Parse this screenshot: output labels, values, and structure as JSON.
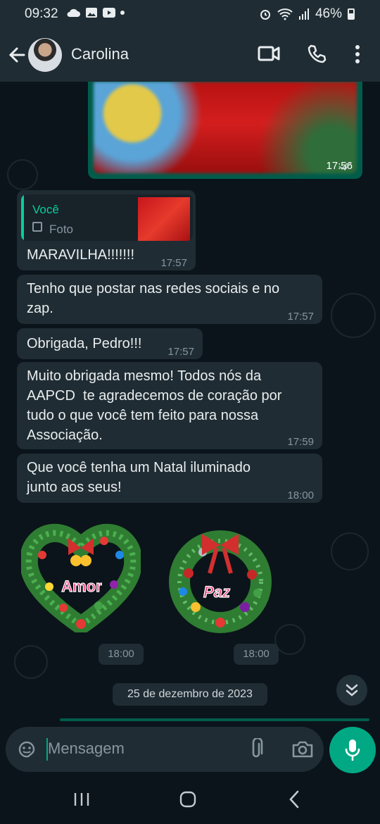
{
  "status_bar": {
    "time": "09:32",
    "battery": "46%"
  },
  "header": {
    "contact_name": "Carolina"
  },
  "messages": {
    "image_time": "17:56",
    "quoted_reply": {
      "who": "Você",
      "what": "Foto",
      "text": "MARAVILHA!!!!!!!",
      "time": "17:57"
    },
    "m1": {
      "text_l1": "Tenho que postar nas redes sociais e no",
      "text_l2": "zap.",
      "time": "17:57"
    },
    "m2": {
      "text": "Obrigada, Pedro!!!",
      "time": "17:57"
    },
    "m3": {
      "text_l1": "Muito obrigada mesmo! Todos nós da",
      "text_l2": "AAPCD  te agradecemos de coração por",
      "text_l3": "tudo o que você tem feito para nossa",
      "text_l4": "Associação.",
      "time": "17:59"
    },
    "m4": {
      "text_l1": "Que você tenha um Natal iluminado",
      "text_l2": "junto aos seus!",
      "time": "18:00"
    },
    "sticker1": {
      "label": "Amor",
      "time": "18:00"
    },
    "sticker2": {
      "label": "Paz",
      "time": "18:00"
    },
    "date_separator": "25 de dezembro de 2023"
  },
  "composer": {
    "placeholder": "Mensagem"
  },
  "colors": {
    "background": "#0b141a",
    "bubble": "#1f2c33",
    "accent": "#00a884",
    "quote_name": "#06cf9c"
  }
}
